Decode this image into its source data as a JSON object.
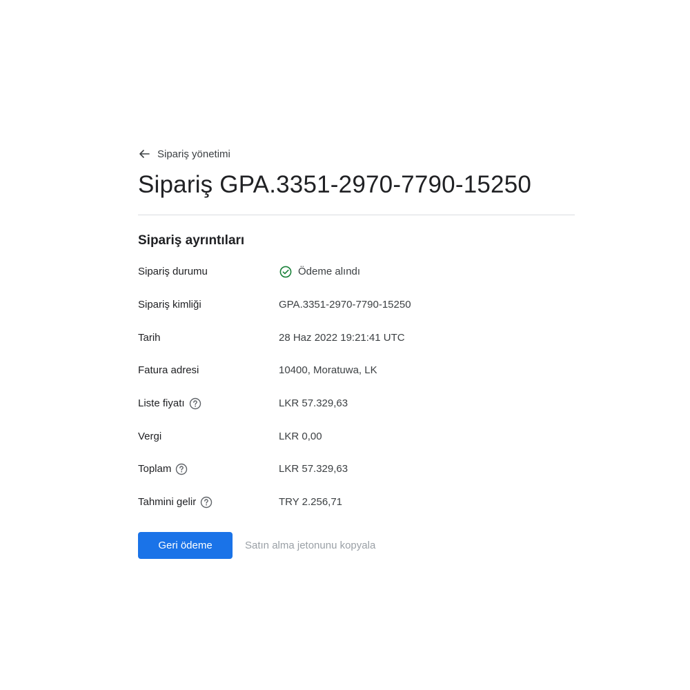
{
  "breadcrumb": {
    "back_label": "Sipariş yönetimi",
    "icon": "arrow-back-icon"
  },
  "page_title": "Sipariş GPA.3351-2970-7790-15250",
  "section": {
    "title": "Sipariş ayrıntıları"
  },
  "details": {
    "status": {
      "label": "Sipariş durumu",
      "value": "Ödeme alındı",
      "icon": "check-circle-icon",
      "icon_color": "#188038"
    },
    "order_id": {
      "label": "Sipariş kimliği",
      "value": "GPA.3351-2970-7790-15250"
    },
    "date": {
      "label": "Tarih",
      "value": "28 Haz 2022 19:21:41 UTC"
    },
    "billing_address": {
      "label": "Fatura adresi",
      "value": "10400, Moratuwa, LK"
    },
    "list_price": {
      "label": "Liste fiyatı",
      "value": "LKR 57.329,63",
      "icon": "help-icon"
    },
    "tax": {
      "label": "Vergi",
      "value": "LKR 0,00"
    },
    "total": {
      "label": "Toplam",
      "value": "LKR 57.329,63",
      "icon": "help-icon"
    },
    "estimated_revenue": {
      "label": "Tahmini gelir",
      "value": "TRY 2.256,71",
      "icon": "help-icon"
    }
  },
  "actions": {
    "refund_label": "Geri ödeme",
    "copy_token_label": "Satın alma jetonunu kopyala"
  },
  "colors": {
    "primary": "#1a73e8",
    "success": "#188038",
    "disabled_text": "#9aa0a6",
    "divider": "#dadce0"
  }
}
